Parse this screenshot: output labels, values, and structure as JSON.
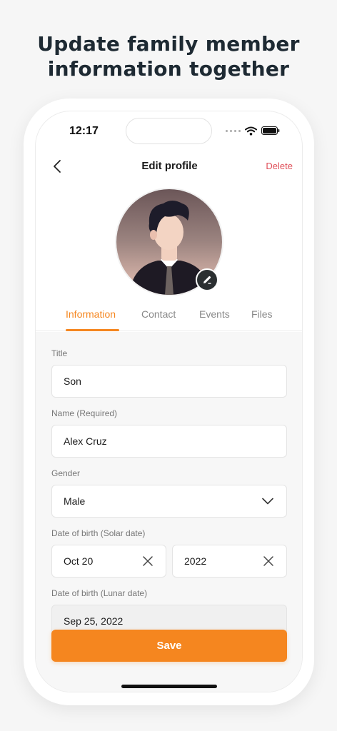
{
  "promo": {
    "line1": "Update family member",
    "line2": "information together"
  },
  "status_bar": {
    "time": "12:17"
  },
  "header": {
    "title": "Edit profile",
    "delete_label": "Delete"
  },
  "tabs": [
    {
      "label": "Information",
      "active": true
    },
    {
      "label": "Contact",
      "active": false
    },
    {
      "label": "Events",
      "active": false
    },
    {
      "label": "Files",
      "active": false
    }
  ],
  "form": {
    "title": {
      "label": "Title",
      "value": "Son"
    },
    "name": {
      "label": "Name (Required)",
      "value": "Alex Cruz"
    },
    "gender": {
      "label": "Gender",
      "value": "Male"
    },
    "dob_solar": {
      "label": "Date of birth (Solar date)",
      "day_month": "Oct 20",
      "year": "2022"
    },
    "dob_lunar": {
      "label": "Date of birth (Lunar date)",
      "value": "Sep 25, 2022"
    }
  },
  "save_label": "Save",
  "colors": {
    "accent": "#f5861f",
    "delete": "#e0505a",
    "badge": "#2b2f31"
  },
  "icons": [
    "back-chevron-icon",
    "pencil-icon",
    "chevron-down-icon",
    "clear-icon",
    "wifi-icon",
    "battery-icon"
  ]
}
